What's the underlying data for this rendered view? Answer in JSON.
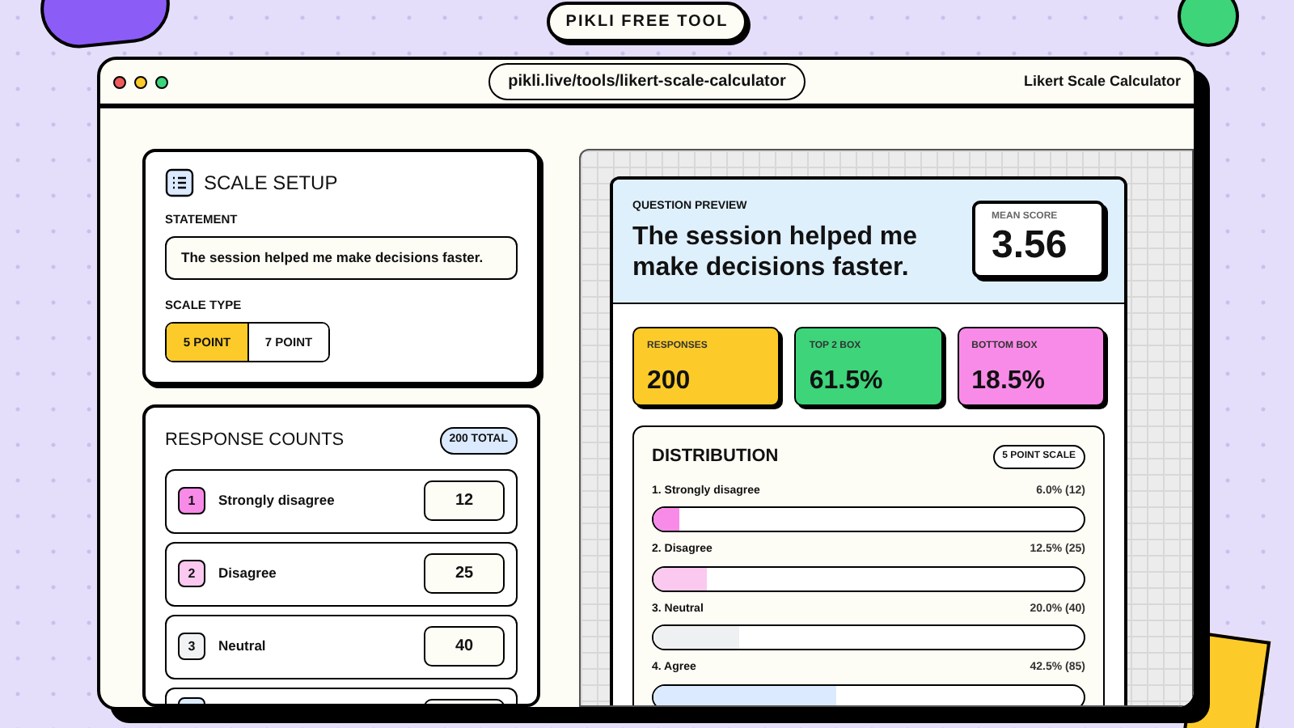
{
  "badge": "PIKLI FREE TOOL",
  "browser": {
    "url": "pikli.live/tools/likert-scale-calculator",
    "title": "Likert Scale Calculator"
  },
  "setup": {
    "title": "SCALE SETUP",
    "statement_label": "STATEMENT",
    "statement_value": "The session helped me make decisions faster.",
    "scale_label": "SCALE TYPE",
    "scale_options": [
      {
        "label": "5 POINT",
        "selected": true
      },
      {
        "label": "7 POINT",
        "selected": false
      }
    ]
  },
  "counts": {
    "title": "RESPONSE COUNTS",
    "total": "200 TOTAL",
    "rows": [
      {
        "number": "1",
        "label": "Strongly disagree",
        "value": "12",
        "color": "#f98be8"
      },
      {
        "number": "2",
        "label": "Disagree",
        "value": "25",
        "color": "#fbc8ef"
      },
      {
        "number": "3",
        "label": "Neutral",
        "value": "40",
        "color": "#f1f2f4"
      },
      {
        "color": "#dbeafe"
      }
    ]
  },
  "preview": {
    "label": "QUESTION PREVIEW",
    "question": "The session helped me make decisions faster.",
    "mean_label": "MEAN SCORE",
    "mean": "3.56",
    "stats": [
      {
        "label": "RESPONSES",
        "value": "200",
        "color": "#fccb2a"
      },
      {
        "label": "TOP 2 BOX",
        "value": "61.5%",
        "color": "#3dd47a"
      },
      {
        "label": "BOTTOM BOX",
        "value": "18.5%",
        "color": "#f98be8"
      }
    ],
    "distribution": {
      "title": "DISTRIBUTION",
      "badge": "5 POINT SCALE",
      "items": [
        {
          "label": "1. Strongly disagree",
          "reading": "6.0% (12)",
          "level": 0.06,
          "color": "#f98be8"
        },
        {
          "label": "2. Disagree",
          "reading": "12.5% (25)",
          "level": 0.125,
          "color": "#fbc8ef"
        },
        {
          "label": "3. Neutral",
          "reading": "20.0% (40)",
          "level": 0.2,
          "color": "#eef0f2"
        },
        {
          "label": "4. Agree",
          "reading": "42.5% (85)",
          "level": 0.425,
          "color": "#dbeafe"
        }
      ]
    }
  }
}
